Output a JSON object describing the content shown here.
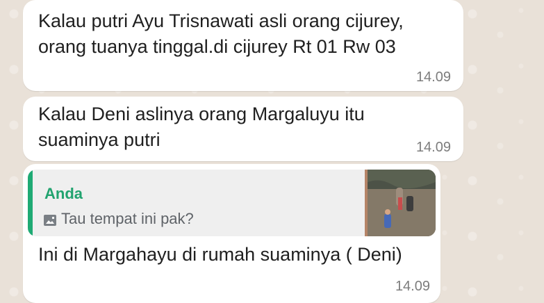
{
  "messages": [
    {
      "text": "Kalau putri Ayu Trisnawati asli orang cijurey,\norang tuanya tinggal.di cijurey Rt 01 Rw 03",
      "time": "14.09"
    },
    {
      "text": "Kalau Deni aslinya orang Margaluyu itu\nsuaminya putri",
      "time": "14.09"
    },
    {
      "quote": {
        "author": "Anda",
        "text": "Tau tempat ini pak?",
        "icon": "photo-icon"
      },
      "text": "Ini di Margahayu di rumah suaminya ( Deni)",
      "time": "14.09"
    }
  ],
  "colors": {
    "background": "#e9e1d8",
    "bubble": "#ffffff",
    "quote_bar": "#1faa74",
    "quote_author": "#21a36f",
    "time_text": "#7c7c7c"
  }
}
